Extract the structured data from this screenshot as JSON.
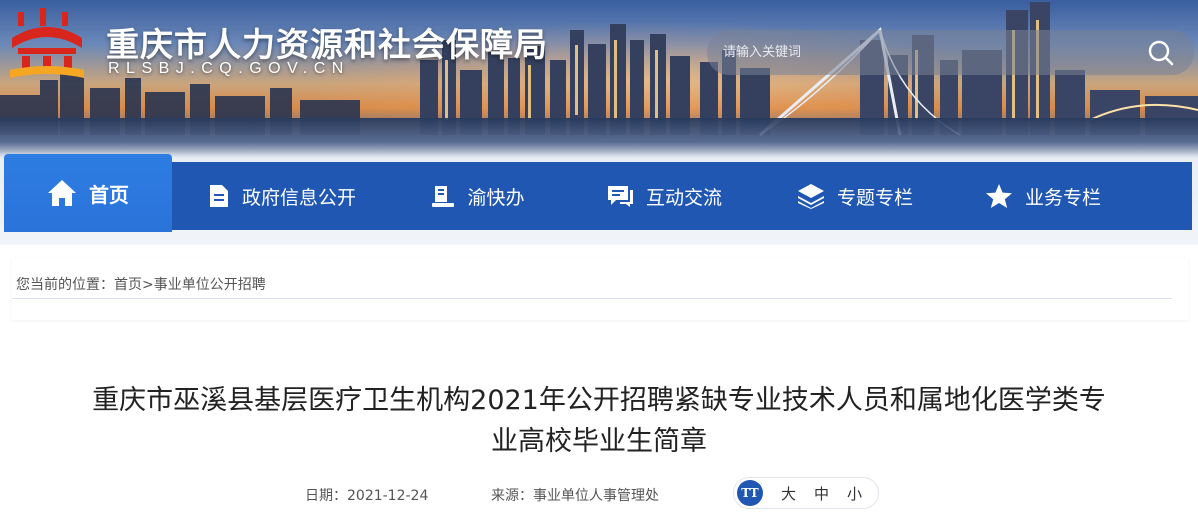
{
  "header": {
    "site_title": "重庆市人力资源和社会保障局",
    "site_domain": "RLSBJ.CQ.GOV.CN",
    "search_placeholder": "请输入关键词"
  },
  "nav": {
    "home": "首页",
    "items": [
      {
        "label": "政府信息公开",
        "icon": "document-icon"
      },
      {
        "label": "渝快办",
        "icon": "stamp-icon"
      },
      {
        "label": "互动交流",
        "icon": "chat-icon"
      },
      {
        "label": "专题专栏",
        "icon": "layers-icon"
      },
      {
        "label": "业务专栏",
        "icon": "star-icon"
      }
    ]
  },
  "breadcrumb": {
    "prefix": "您当前的位置：",
    "home": "首页",
    "separator": ">",
    "current": "事业单位公开招聘"
  },
  "article": {
    "title_line1": "重庆市巫溪县基层医疗卫生机构2021年公开招聘紧缺专业技术人员和属地化医学类专",
    "title_line2": "业高校毕业生简章",
    "date_label": "日期：",
    "date": "2021-12-24",
    "source_label": "来源：",
    "source": "事业单位人事管理处"
  },
  "font_size": {
    "icon_text": "TT",
    "large": "大",
    "medium": "中",
    "small": "小"
  },
  "colors": {
    "nav_bg": "#1f57b3",
    "nav_active": "#2a73d9",
    "logo_red": "#d9261c",
    "logo_orange": "#f5a623"
  }
}
